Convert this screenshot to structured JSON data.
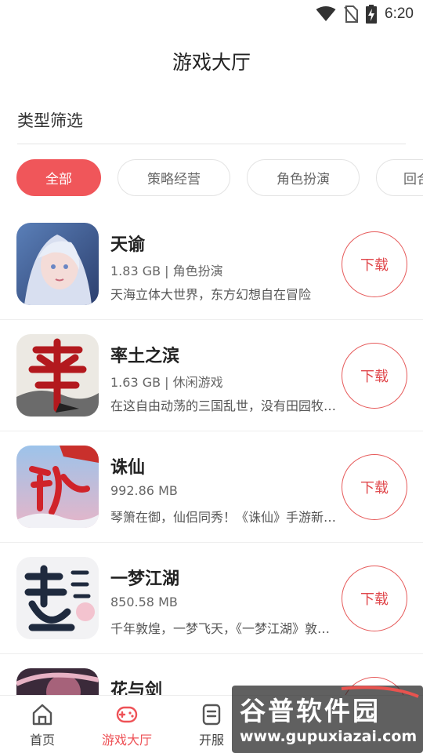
{
  "status_bar": {
    "time": "6:20"
  },
  "page_title": "游戏大厅",
  "filter": {
    "heading": "类型筛选",
    "chips": [
      {
        "label": "全部",
        "active": true
      },
      {
        "label": "策略经营",
        "active": false
      },
      {
        "label": "角色扮演",
        "active": false
      },
      {
        "label": "回合",
        "active": false
      }
    ]
  },
  "games": [
    {
      "name": "天谕",
      "meta": "1.83 GB | 角色扮演",
      "desc": "天海立体大世界，东方幻想自在冒险",
      "button": "下载",
      "icon": "tianyu-game-icon"
    },
    {
      "name": "率土之滨",
      "meta": "1.63 GB | 休闲游戏",
      "desc": "在这自由动荡的三国乱世，没有田园牧…",
      "button": "下载",
      "icon": "shuaitu-game-icon"
    },
    {
      "name": "诛仙",
      "meta": "992.86 MB",
      "desc": "琴箫在御，仙侣同秀！《诛仙》手游新…",
      "button": "下载",
      "icon": "zhuxian-game-icon"
    },
    {
      "name": "一梦江湖",
      "meta": "850.58 MB",
      "desc": "千年敦煌，一梦飞天，《一梦江湖》敦…",
      "button": "下载",
      "icon": "yimeng-game-icon"
    },
    {
      "name": "花与剑",
      "meta": "",
      "desc": "",
      "button": "下载",
      "icon": "huayujian-game-icon"
    }
  ],
  "tabs": [
    {
      "label": "首页",
      "icon": "home-icon",
      "active": false
    },
    {
      "label": "游戏大厅",
      "icon": "gamepad-icon",
      "active": true
    },
    {
      "label": "开服",
      "icon": "server-list-icon",
      "active": false
    },
    {
      "label": "",
      "icon": "",
      "active": false
    },
    {
      "label": "",
      "icon": "",
      "active": false
    }
  ],
  "watermark": {
    "title": "谷普软件园",
    "url": "www.gupuxiazai.com"
  },
  "colors": {
    "accent": "#f0565a",
    "text": "#222222",
    "muted": "#666666"
  }
}
